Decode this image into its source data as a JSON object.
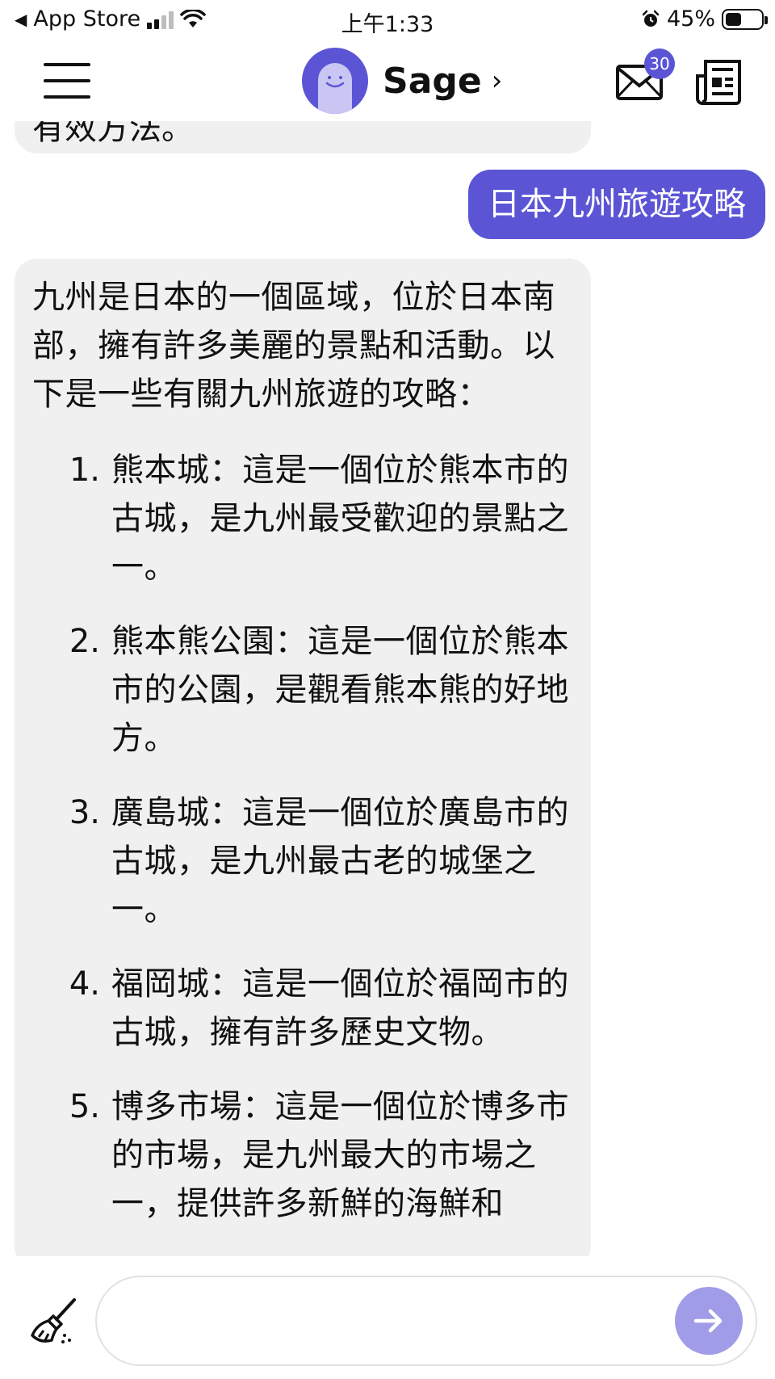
{
  "status_bar": {
    "back_app": "App Store",
    "time": "上午1:33",
    "battery": "45%"
  },
  "header": {
    "bot_name": "Sage",
    "chevron": "›",
    "mail_badge": "30",
    "icons": [
      "menu-icon",
      "avatar",
      "mail-icon",
      "news-icon"
    ]
  },
  "messages": {
    "previous_bot_tail": "有效方法。",
    "user_message": "日本九州旅遊攻略",
    "bot_intro": "九州是日本的一個區域，位於日本南部，擁有許多美麗的景點和活動。以下是一些有關九州旅遊的攻略：",
    "bot_items": [
      {
        "num": "1.",
        "text": "熊本城：這是一個位於熊本市的古城，是九州最受歡迎的景點之一。"
      },
      {
        "num": "2.",
        "text": "熊本熊公園：這是一個位於熊本市的公園，是觀看熊本熊的好地方。"
      },
      {
        "num": "3.",
        "text": "廣島城：這是一個位於廣島市的古城，是九州最古老的城堡之一。"
      },
      {
        "num": "4.",
        "text": "福岡城：這是一個位於福岡市的古城，擁有許多歷史文物。"
      },
      {
        "num": "5.",
        "text": "博多市場：這是一個位於博多市的市場，是九州最大的市場之一，提供許多新鮮的海鮮和"
      }
    ]
  },
  "composer": {
    "placeholder": "",
    "icons": [
      "broom-icon",
      "send-arrow-icon"
    ]
  },
  "colors": {
    "accent": "#5b55d6",
    "bubble_bg": "#f0f0f0",
    "send_button": "#a09ce8"
  }
}
